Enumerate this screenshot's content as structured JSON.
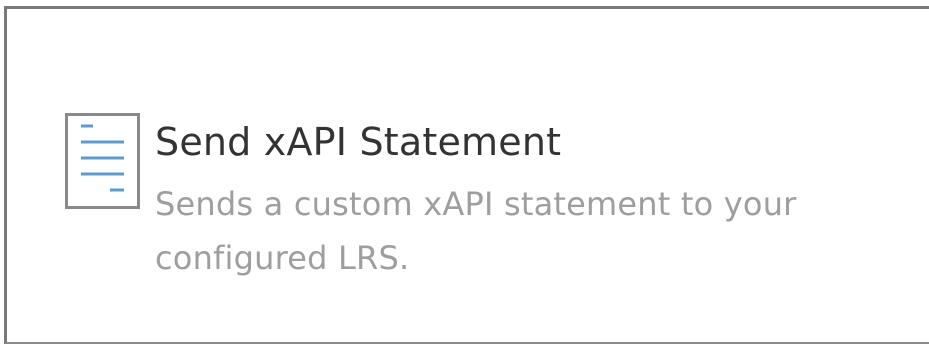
{
  "action_card": {
    "icon": "document-icon",
    "title": "Send xAPI Statement",
    "description": "Sends a custom xAPI statement to your configured LRS.",
    "colors": {
      "icon_lines": "#5b9bd5",
      "icon_border": "#8a8a8a",
      "title": "#333333",
      "description": "#9e9e9e"
    }
  }
}
